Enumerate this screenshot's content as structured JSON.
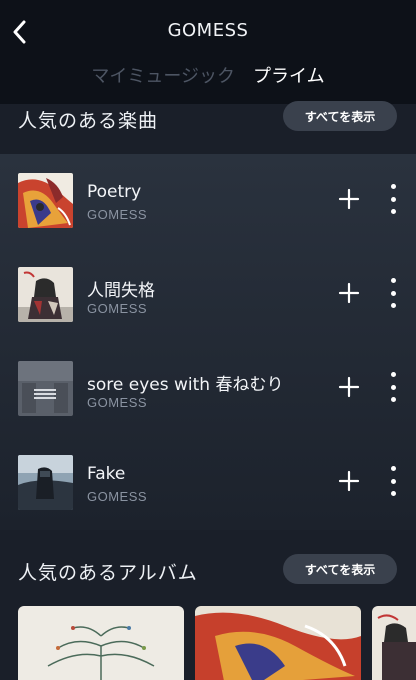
{
  "header": {
    "title": "GOMESS",
    "tabs": [
      {
        "label": "マイミュージック",
        "active": false
      },
      {
        "label": "プライム",
        "active": true
      }
    ]
  },
  "popular_songs": {
    "title": "人気のある楽曲",
    "show_all_label": "すべてを表示",
    "items": [
      {
        "title": "Poetry",
        "artist": "GOMESS"
      },
      {
        "title": "人間失格",
        "artist": "GOMESS"
      },
      {
        "title": "sore eyes with 春ねむり",
        "artist": "GOMESS"
      },
      {
        "title": "Fake",
        "artist": "GOMESS"
      }
    ]
  },
  "popular_albums": {
    "title": "人気のあるアルバム",
    "show_all_label": "すべてを表示"
  },
  "colors": {
    "header_bg": "#0d1118",
    "list_bg": "#2a323e",
    "pill_bg": "#3a414d",
    "subtext": "#8a93a1",
    "inactive_tab": "#4d5563"
  },
  "icons": [
    "back-chevron-icon",
    "plus-icon",
    "more-vertical-icon"
  ]
}
